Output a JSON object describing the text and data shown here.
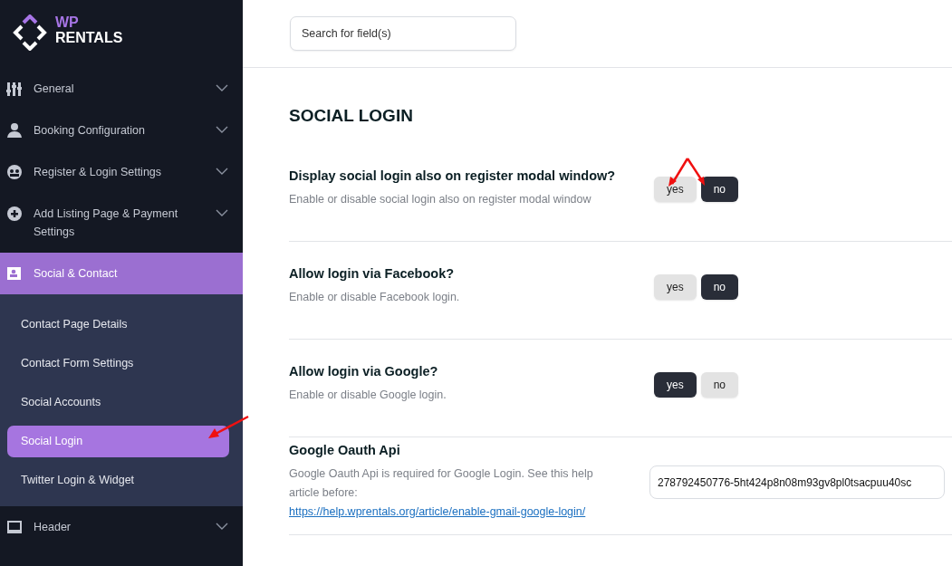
{
  "logo": {
    "line1": "WP",
    "line2": "RENTALS"
  },
  "sidebar": {
    "items": [
      {
        "label": "General",
        "expanded": false
      },
      {
        "label": "Booking Configuration",
        "expanded": false
      },
      {
        "label": "Register & Login Settings",
        "expanded": false
      },
      {
        "label": "Add Listing Page & Payment Settings",
        "expanded": false
      },
      {
        "label": "Social & Contact",
        "expanded": true,
        "children": [
          {
            "label": "Contact Page Details",
            "selected": false
          },
          {
            "label": "Contact Form Settings",
            "selected": false
          },
          {
            "label": "Social Accounts",
            "selected": false
          },
          {
            "label": "Social Login",
            "selected": true
          },
          {
            "label": "Twitter Login & Widget",
            "selected": false
          }
        ]
      },
      {
        "label": "Header",
        "expanded": false
      }
    ]
  },
  "search": {
    "placeholder": "Search for field(s)"
  },
  "section_title": "SOCIAL LOGIN",
  "settings": [
    {
      "kind": "toggle",
      "title": "Display social login also on register modal window?",
      "description": "Enable or disable social login also on register modal window",
      "options": [
        {
          "label": "yes",
          "selected": false
        },
        {
          "label": "no",
          "selected": true
        }
      ]
    },
    {
      "kind": "toggle",
      "title": "Allow login via Facebook?",
      "description": "Enable or disable Facebook login.",
      "options": [
        {
          "label": "yes",
          "selected": false
        },
        {
          "label": "no",
          "selected": true
        }
      ]
    },
    {
      "kind": "toggle",
      "title": "Allow login via Google?",
      "description": "Enable or disable Google login.",
      "options": [
        {
          "label": "yes",
          "selected": true
        },
        {
          "label": "no",
          "selected": false
        }
      ]
    },
    {
      "kind": "text",
      "title": "Google Oauth Api",
      "description": "Google Oauth Api is required for Google Login. See this help article before:",
      "link": "https://help.wprentals.org/article/enable-gmail-google-login/",
      "value": "278792450776-5ht424p8n08m93gv8pl0tsacpuu40sc"
    }
  ]
}
